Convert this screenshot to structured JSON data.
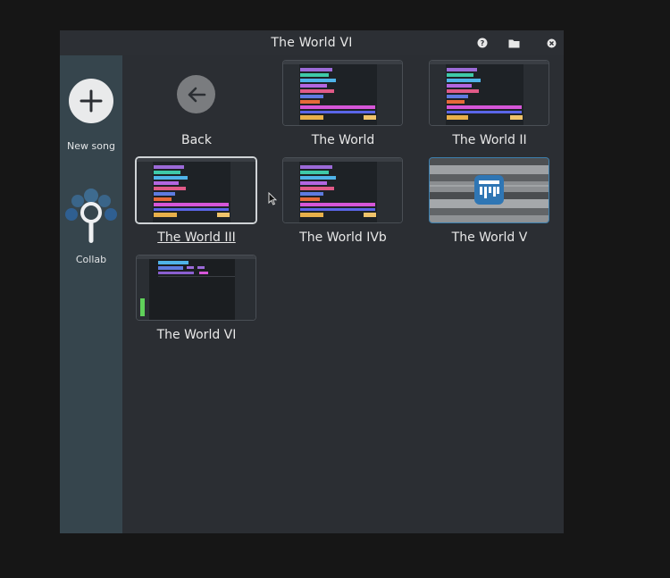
{
  "window": {
    "title": "The World VI",
    "toolbar": {
      "help_icon": "help-icon",
      "folder_icon": "folder-icon",
      "close_icon": "close-icon"
    }
  },
  "sidebar": {
    "new_song": {
      "icon": "plus-icon",
      "label": "New song"
    },
    "collab": {
      "icon": "collab-icon",
      "label": "Collab"
    }
  },
  "grid": {
    "back": {
      "icon": "arrow-left-icon",
      "label": "Back"
    },
    "songs": [
      {
        "label": "The World"
      },
      {
        "label": "The World II"
      },
      {
        "label": "The World III",
        "selected": true
      },
      {
        "label": "The World IVb"
      },
      {
        "label": "The World V"
      },
      {
        "label": "The World VI"
      }
    ]
  },
  "colors": {
    "window_bg": "#2b2e33",
    "sidebar_bg": "#36454d",
    "accent_blue": "#2f76b4"
  }
}
